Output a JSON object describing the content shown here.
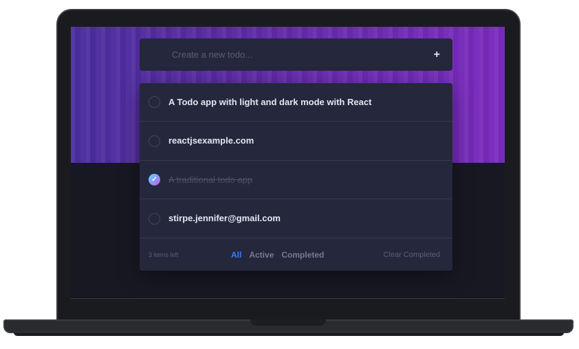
{
  "app": {
    "new_todo_placeholder": "Create a new todo...",
    "add_symbol": "+",
    "check_symbol": "✓"
  },
  "todos": [
    {
      "text": "A Todo app with light and dark mode with React",
      "completed": false
    },
    {
      "text": "reactjsexample.com",
      "completed": false
    },
    {
      "text": "A traditional todo app",
      "completed": true
    },
    {
      "text": "stirpe.jennifer@gmail.com",
      "completed": false
    }
  ],
  "footer": {
    "items_left": "3 items left",
    "filters": [
      "All",
      "Active",
      "Completed"
    ],
    "active_filter": "All",
    "clear_label": "Clear Completed"
  },
  "colors": {
    "accent": "#3a7cfd",
    "card": "#25273c",
    "background": "#171822",
    "check_gradient_start": "#57ddff",
    "check_gradient_end": "#c058f3"
  }
}
